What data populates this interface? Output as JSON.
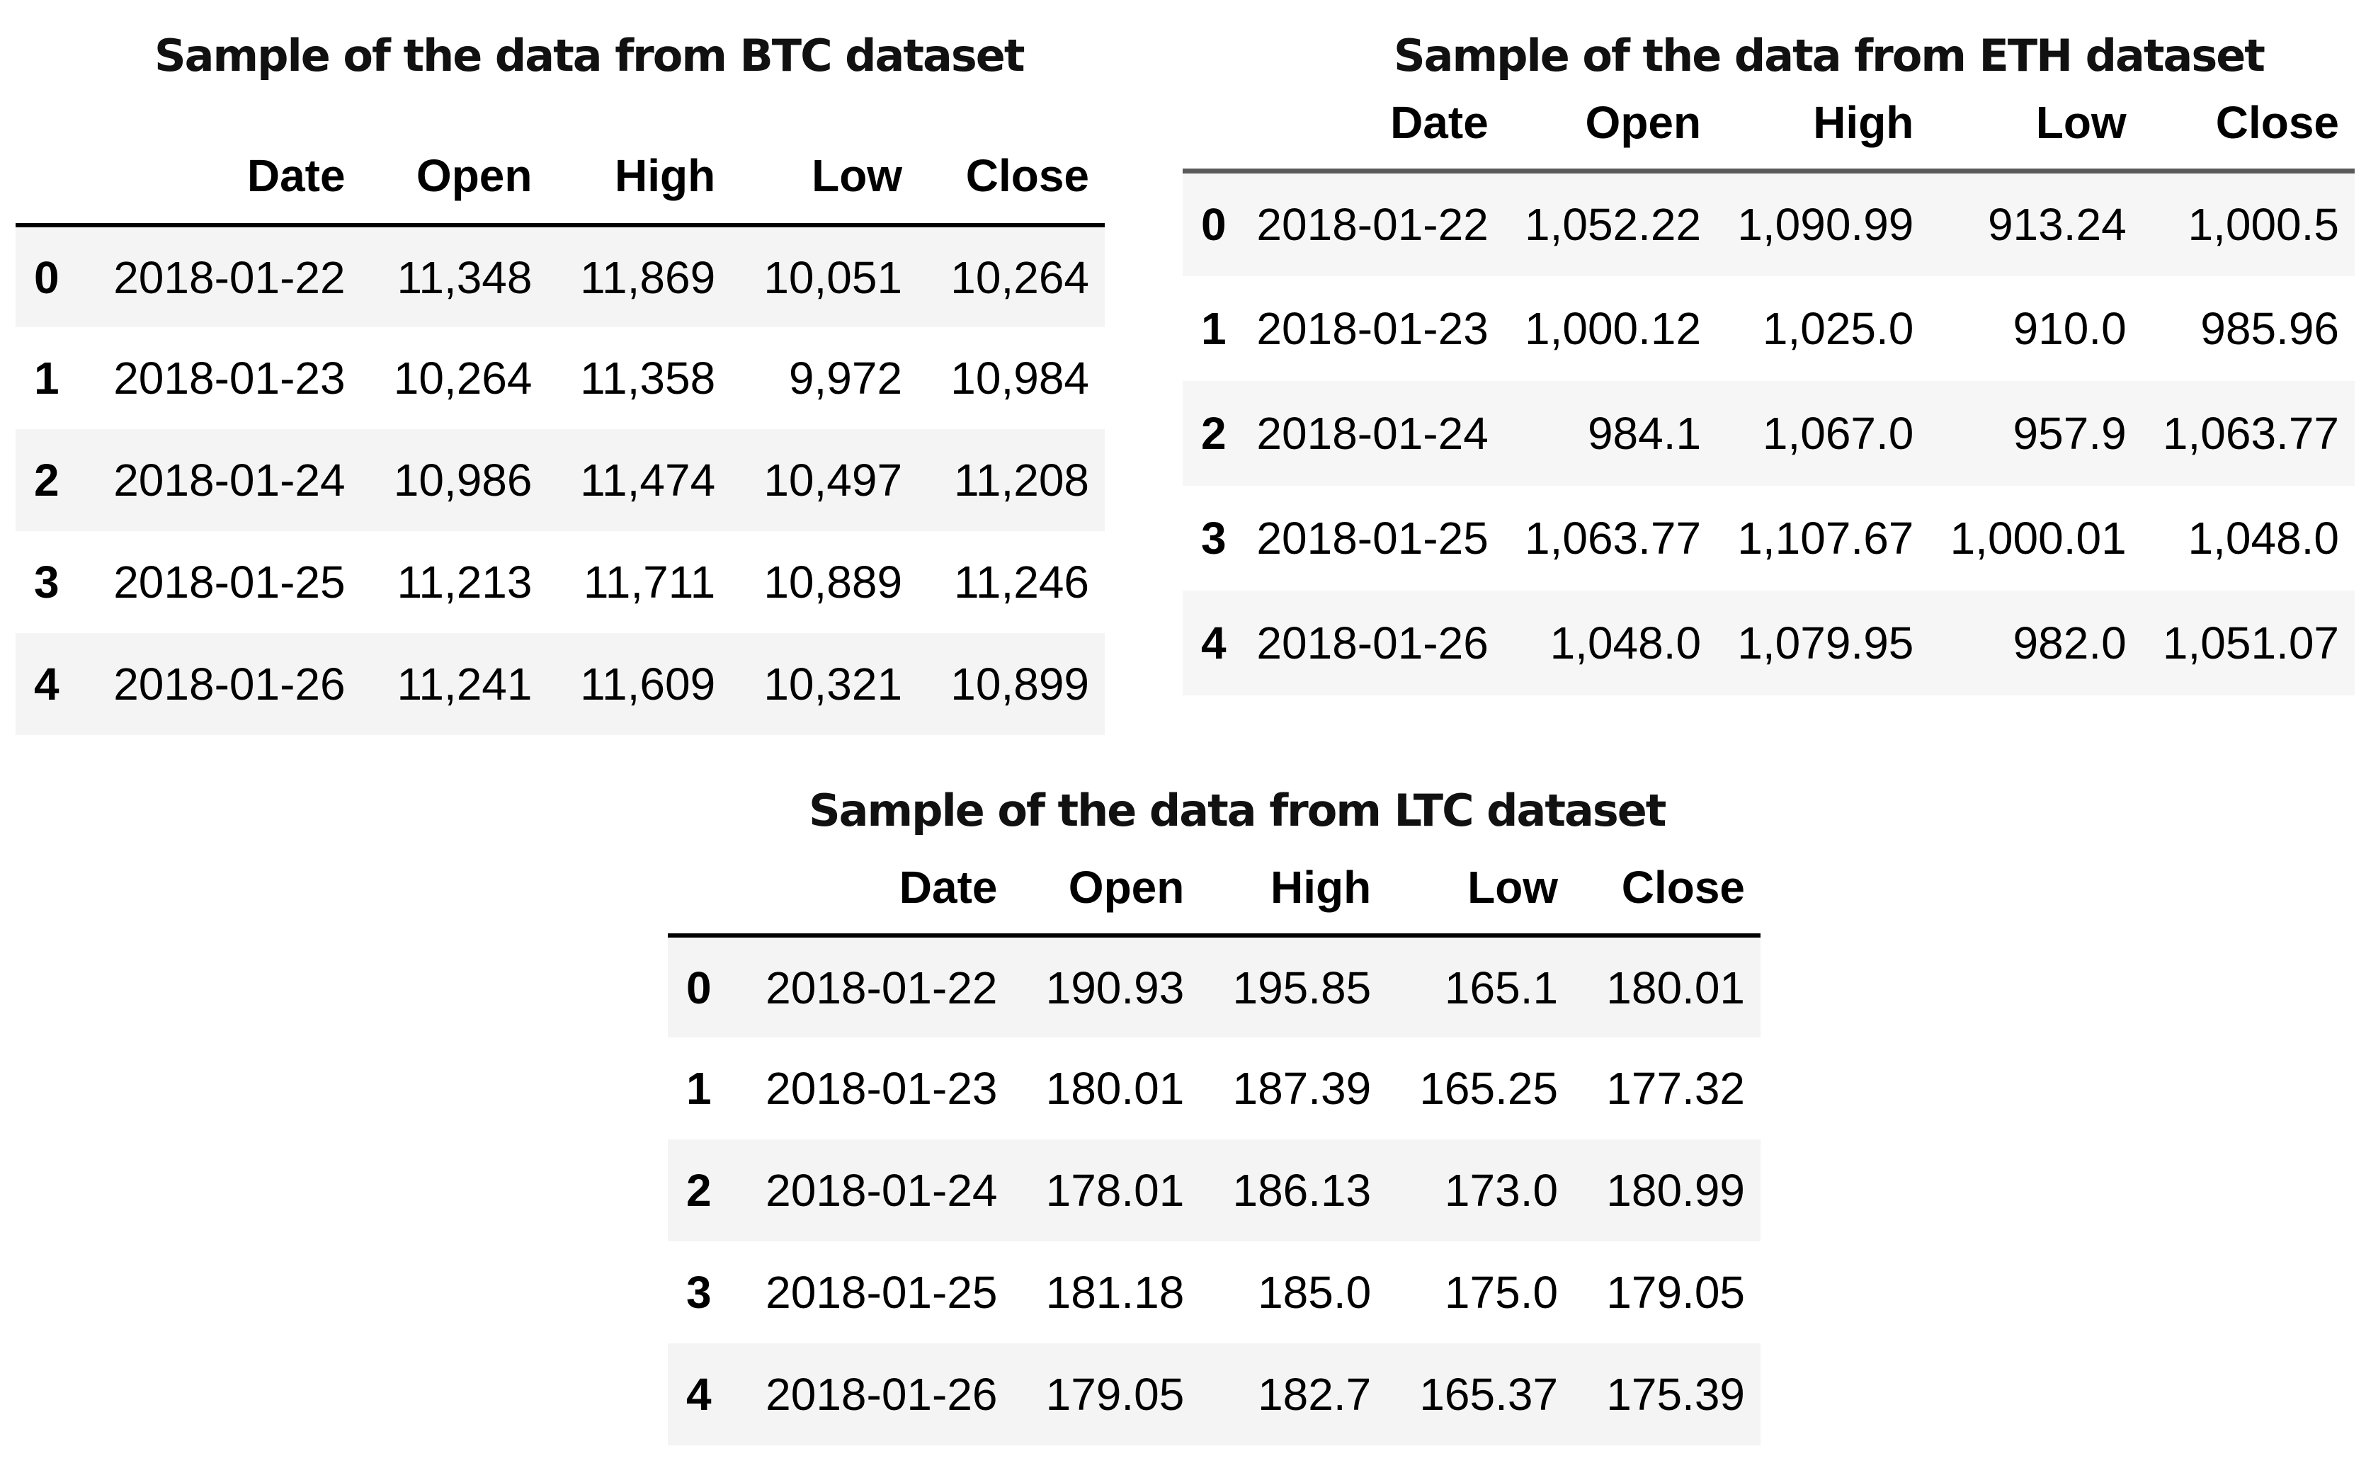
{
  "tables": {
    "btc": {
      "title": "Sample of the data from BTC dataset",
      "columns": [
        "",
        "Date",
        "Open",
        "High",
        "Low",
        "Close"
      ],
      "rows": [
        [
          "0",
          "2018-01-22",
          "11,348",
          "11,869",
          "10,051",
          "10,264"
        ],
        [
          "1",
          "2018-01-23",
          "10,264",
          "11,358",
          "9,972",
          "10,984"
        ],
        [
          "2",
          "2018-01-24",
          "10,986",
          "11,474",
          "10,497",
          "11,208"
        ],
        [
          "3",
          "2018-01-25",
          "11,213",
          "11,711",
          "10,889",
          "11,246"
        ],
        [
          "4",
          "2018-01-26",
          "11,241",
          "11,609",
          "10,321",
          "10,899"
        ]
      ]
    },
    "eth": {
      "title": "Sample of the data from ETH dataset",
      "columns": [
        "",
        "Date",
        "Open",
        "High",
        "Low",
        "Close"
      ],
      "rows": [
        [
          "0",
          "2018-01-22",
          "1,052.22",
          "1,090.99",
          "913.24",
          "1,000.5"
        ],
        [
          "1",
          "2018-01-23",
          "1,000.12",
          "1,025.0",
          "910.0",
          "985.96"
        ],
        [
          "2",
          "2018-01-24",
          "984.1",
          "1,067.0",
          "957.9",
          "1,063.77"
        ],
        [
          "3",
          "2018-01-25",
          "1,063.77",
          "1,107.67",
          "1,000.01",
          "1,048.0"
        ],
        [
          "4",
          "2018-01-26",
          "1,048.0",
          "1,079.95",
          "982.0",
          "1,051.07"
        ]
      ]
    },
    "ltc": {
      "title": "Sample of the data from LTC dataset",
      "columns": [
        "",
        "Date",
        "Open",
        "High",
        "Low",
        "Close"
      ],
      "rows": [
        [
          "0",
          "2018-01-22",
          "190.93",
          "195.85",
          "165.1",
          "180.01"
        ],
        [
          "1",
          "2018-01-23",
          "180.01",
          "187.39",
          "165.25",
          "177.32"
        ],
        [
          "2",
          "2018-01-24",
          "178.01",
          "186.13",
          "173.0",
          "180.99"
        ],
        [
          "3",
          "2018-01-25",
          "181.18",
          "185.0",
          "175.0",
          "179.05"
        ],
        [
          "4",
          "2018-01-26",
          "179.05",
          "182.7",
          "165.37",
          "175.39"
        ]
      ]
    }
  }
}
